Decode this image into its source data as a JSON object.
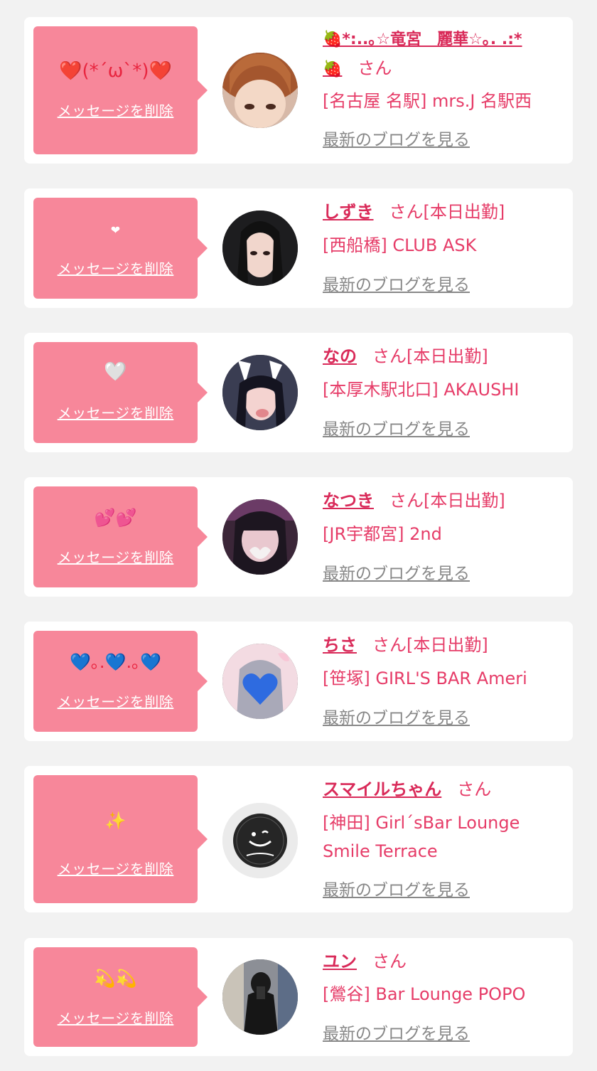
{
  "delete_label": "メッセージを削除",
  "blog_label": "最新のブログを見る",
  "honorific": "さん",
  "colors": {
    "background": "#f2f2f2",
    "card": "#ffffff",
    "bubble": "#f7879a",
    "name": "#d92a59",
    "text": "#e63c68",
    "blog_link": "#888888"
  },
  "entries": [
    {
      "message": "❤️(*´ω`*)❤️",
      "name_line1": "🍓*:..｡☆竜宮　麗華☆｡. .:*",
      "name_line2": "🍓",
      "status": "",
      "shop": "[名古屋 名駅] mrs.J 名駅西",
      "shop_line2": "",
      "avatar": "avatar-red-hair"
    },
    {
      "message": "❤",
      "name_line1": "しずき",
      "status": "[本日出勤]",
      "shop": "[西船橋] CLUB ASK",
      "shop_line2": "",
      "avatar": "avatar-dark-hair"
    },
    {
      "message": "🤍",
      "name_line1": "なの",
      "status": "[本日出勤]",
      "shop": "[本厚木駅北口] AKAUSHI",
      "shop_line2": "",
      "avatar": "avatar-bunny"
    },
    {
      "message": "💕💕",
      "name_line1": "なつき",
      "status": "[本日出勤]",
      "shop": "[JR宇都宮] 2nd",
      "shop_line2": "",
      "avatar": "avatar-heart-hands"
    },
    {
      "message": "💙｡.💙.｡💙",
      "name_line1": "ちさ",
      "status": "[本日出勤]",
      "shop": "[笹塚] GIRL'S BAR Ameri",
      "shop_line2": "",
      "avatar": "avatar-blue-heart"
    },
    {
      "message": "✨",
      "name_line1": "スマイルちゃん",
      "status": "",
      "shop": "[神田] Girl´sBar Lounge",
      "shop_line2": "Smile Terrace",
      "avatar": "avatar-smile-logo"
    },
    {
      "message": "💫💫",
      "name_line1": "ユン",
      "status": "",
      "shop": "[鶯谷] Bar Lounge POPO",
      "shop_line2": "",
      "avatar": "avatar-mirror-selfie"
    }
  ]
}
